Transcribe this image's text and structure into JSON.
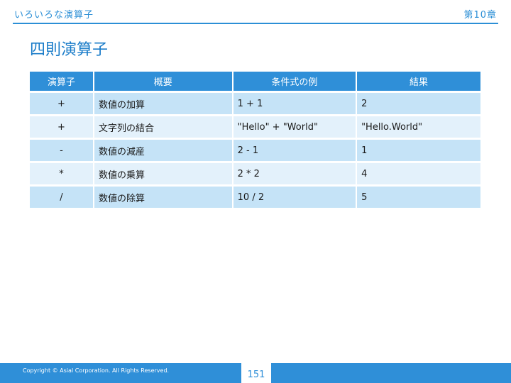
{
  "header": {
    "left": "いろいろな演算子",
    "right": "第10章"
  },
  "title": "四則演算子",
  "table": {
    "columns": [
      "演算子",
      "概要",
      "条件式の例",
      "結果"
    ],
    "rows": [
      {
        "op": "+",
        "desc": "数値の加算",
        "example": "1 + 1",
        "result": "2"
      },
      {
        "op": "+",
        "desc": "文字列の結合",
        "example": "\"Hello\" + \"World\"",
        "result": "\"Hello.World\""
      },
      {
        "op": "-",
        "desc": "数値の減産",
        "example": "2 - 1",
        "result": "1"
      },
      {
        "op": "*",
        "desc": "数値の乗算",
        "example": "2 * 2",
        "result": "4"
      },
      {
        "op": "/",
        "desc": "数値の除算",
        "example": "10 / 2",
        "result": "5"
      }
    ]
  },
  "footer": {
    "copyright": "Copyright © Asial Corporation. All Rights Reserved.",
    "page": "151"
  },
  "colors": {
    "accent": "#2f8fd8",
    "row_odd": "#c5e3f7",
    "row_even": "#e3f1fb"
  }
}
